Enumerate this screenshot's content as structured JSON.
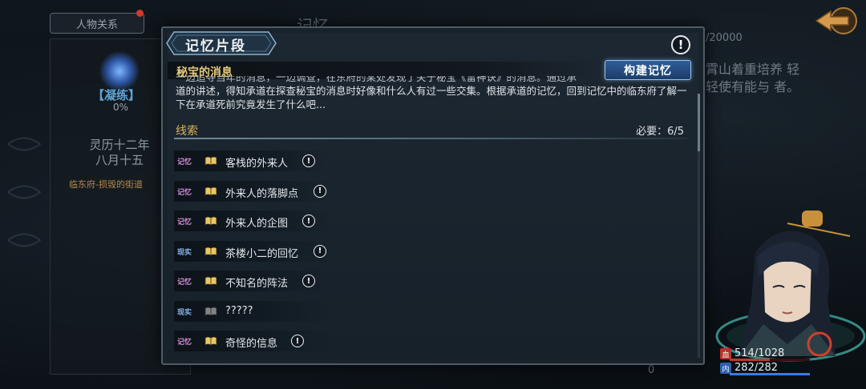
{
  "background": {
    "tab_label": "人物关系",
    "title": "记忆",
    "realm_label": "【凝练】",
    "progress": "0%",
    "date_line1": "灵历十二年",
    "date_line2": "八月十五",
    "location": "临东府-损毁的街道",
    "right_count": "/20000",
    "right_text": "霄山着重培养 轻轻使有能与 者。",
    "bottom_num": "0"
  },
  "dialog": {
    "title": "记忆片段",
    "info_icon": "!",
    "subtitle": "秘宝的消息",
    "build_button": "构建记忆",
    "description_cut": "一边追寻当年的消息，一边调查，在东府的某处发现了关于秘宝《雷神诀》的消息。通过承",
    "description": "道的讲述，得知承道在探查秘宝的消息时好像和什么人有过一些交集。根据承道的记忆，回到记忆中的临东府了解一下在承道死前究竟发生了什么吧...",
    "clues_label": "线索",
    "clues_required": "必要：6/5"
  },
  "clues": [
    {
      "tag": "记忆",
      "type": "memory",
      "text": "客栈的外来人",
      "has_info": true,
      "book": "gold"
    },
    {
      "tag": "记忆",
      "type": "memory",
      "text": "外来人的落脚点",
      "has_info": true,
      "book": "gold"
    },
    {
      "tag": "记忆",
      "type": "memory",
      "text": "外来人的企图",
      "has_info": true,
      "book": "gold"
    },
    {
      "tag": "现实",
      "type": "reality",
      "text": "茶楼小二的回忆",
      "has_info": true,
      "book": "gold"
    },
    {
      "tag": "记忆",
      "type": "memory",
      "text": "不知名的阵法",
      "has_info": true,
      "book": "gold"
    },
    {
      "tag": "现实",
      "type": "reality",
      "text": "?????",
      "has_info": false,
      "book": "gray"
    },
    {
      "tag": "记忆",
      "type": "memory",
      "text": "奇怪的信息",
      "has_info": true,
      "book": "gold"
    }
  ],
  "character": {
    "hp_icon": "血",
    "hp": "514/1028",
    "hp_ratio": 0.5,
    "mp_icon": "内",
    "mp": "282/282",
    "mp_ratio": 1.0
  },
  "colors": {
    "memory_tag": "#d08ad6",
    "reality_tag": "#86b3e8",
    "accent_gold": "#e6c879",
    "build_button": "#2f5e98"
  }
}
